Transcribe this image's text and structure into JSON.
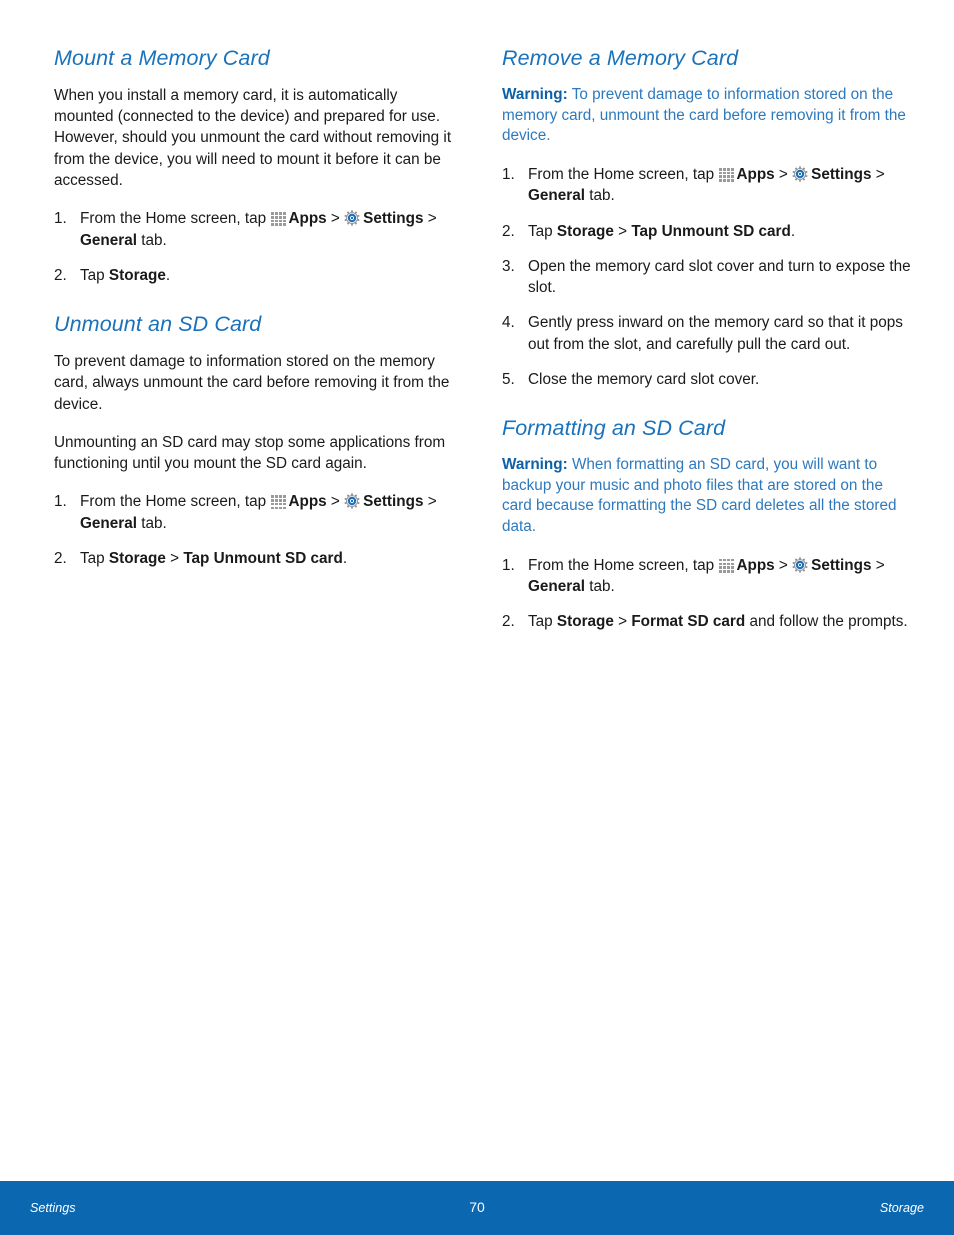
{
  "page": {
    "number": "70",
    "footer_left": "Settings",
    "footer_right": "Storage",
    "accent_blue": "#1a72bb",
    "footer_blue": "#0a67b0",
    "warning_blue": "#2d79bd",
    "body_color": "#1a1a1a"
  },
  "icons": {
    "apps": "apps-grid-icon",
    "settings": "settings-gear-icon"
  },
  "left_column": {
    "sections": [
      {
        "heading": "Mount a Memory Card",
        "paragraphs": [
          "When you install a memory card, it is automatically mounted (connected to the device) and prepared for use. However, should you unmount the card without removing it from the device, you will need to mount it before it can be accessed."
        ],
        "steps": [
          {
            "parts": [
              {
                "type": "text",
                "value": "From the Home screen, tap "
              },
              {
                "type": "icon",
                "value": "apps-grid-icon"
              },
              {
                "type": "bold",
                "value": "Apps"
              },
              {
                "type": "text",
                "value": " > "
              },
              {
                "type": "icon",
                "value": "settings-gear-icon"
              },
              {
                "type": "bold",
                "value": "Settings"
              },
              {
                "type": "text",
                "value": " > "
              },
              {
                "type": "bold",
                "value": "General"
              },
              {
                "type": "text",
                "value": " tab."
              }
            ]
          },
          {
            "parts": [
              {
                "type": "text",
                "value": "Tap "
              },
              {
                "type": "bold",
                "value": "Storage"
              },
              {
                "type": "text",
                "value": "."
              }
            ]
          }
        ]
      },
      {
        "heading": "Unmount an SD Card",
        "paragraphs": [
          "To prevent damage to information stored on the memory card, always unmount the card before removing it from the device.",
          "Unmounting an SD card may stop some applications from functioning until you mount the SD card again."
        ],
        "steps": [
          {
            "parts": [
              {
                "type": "text",
                "value": "From the Home screen, tap "
              },
              {
                "type": "icon",
                "value": "apps-grid-icon"
              },
              {
                "type": "bold",
                "value": "Apps"
              },
              {
                "type": "text",
                "value": " > "
              },
              {
                "type": "icon",
                "value": "settings-gear-icon"
              },
              {
                "type": "bold",
                "value": "Settings"
              },
              {
                "type": "text",
                "value": " > "
              },
              {
                "type": "bold",
                "value": "General"
              },
              {
                "type": "text",
                "value": " tab."
              }
            ]
          },
          {
            "parts": [
              {
                "type": "text",
                "value": "Tap "
              },
              {
                "type": "bold",
                "value": "Storage"
              },
              {
                "type": "text",
                "value": " > "
              },
              {
                "type": "bold",
                "value": "Tap Unmount SD card"
              },
              {
                "type": "text",
                "value": "."
              }
            ]
          }
        ]
      }
    ]
  },
  "right_column": {
    "sections": [
      {
        "heading": "Remove a Memory Card",
        "warning": {
          "label": "Warning:",
          "text": " To prevent damage to information stored on the memory card, unmount the card before removing it from the device."
        },
        "steps": [
          {
            "parts": [
              {
                "type": "text",
                "value": "From the Home screen, tap "
              },
              {
                "type": "icon",
                "value": "apps-grid-icon"
              },
              {
                "type": "bold",
                "value": "Apps"
              },
              {
                "type": "text",
                "value": " > "
              },
              {
                "type": "icon",
                "value": "settings-gear-icon"
              },
              {
                "type": "bold",
                "value": "Settings"
              },
              {
                "type": "text",
                "value": " > "
              },
              {
                "type": "bold",
                "value": "General"
              },
              {
                "type": "text",
                "value": " tab."
              }
            ]
          },
          {
            "parts": [
              {
                "type": "text",
                "value": "Tap "
              },
              {
                "type": "bold",
                "value": "Storage"
              },
              {
                "type": "text",
                "value": " > "
              },
              {
                "type": "bold",
                "value": "Tap Unmount SD card"
              },
              {
                "type": "text",
                "value": "."
              }
            ]
          },
          {
            "parts": [
              {
                "type": "text",
                "value": "Open the memory card slot cover and turn to expose the slot."
              }
            ]
          },
          {
            "parts": [
              {
                "type": "text",
                "value": "Gently press inward on the memory card so that it pops out from the slot, and carefully pull the card out."
              }
            ]
          },
          {
            "parts": [
              {
                "type": "text",
                "value": "Close the memory card slot cover."
              }
            ]
          }
        ]
      },
      {
        "heading": "Formatting an SD Card",
        "warning": {
          "label": "Warning:",
          "text": " When formatting an SD card, you will want to backup your music and photo files that are stored on the card because formatting the SD card deletes all the stored data."
        },
        "steps": [
          {
            "parts": [
              {
                "type": "text",
                "value": "From the Home screen, tap "
              },
              {
                "type": "icon",
                "value": "apps-grid-icon"
              },
              {
                "type": "bold",
                "value": "Apps"
              },
              {
                "type": "text",
                "value": " > "
              },
              {
                "type": "icon",
                "value": "settings-gear-icon"
              },
              {
                "type": "bold",
                "value": "Settings"
              },
              {
                "type": "text",
                "value": " > "
              },
              {
                "type": "bold",
                "value": "General"
              },
              {
                "type": "text",
                "value": " tab."
              }
            ]
          },
          {
            "parts": [
              {
                "type": "text",
                "value": "Tap "
              },
              {
                "type": "bold",
                "value": "Storage"
              },
              {
                "type": "text",
                "value": " > "
              },
              {
                "type": "bold",
                "value": "Format SD card"
              },
              {
                "type": "text",
                "value": " and follow the prompts."
              }
            ]
          }
        ]
      }
    ]
  }
}
